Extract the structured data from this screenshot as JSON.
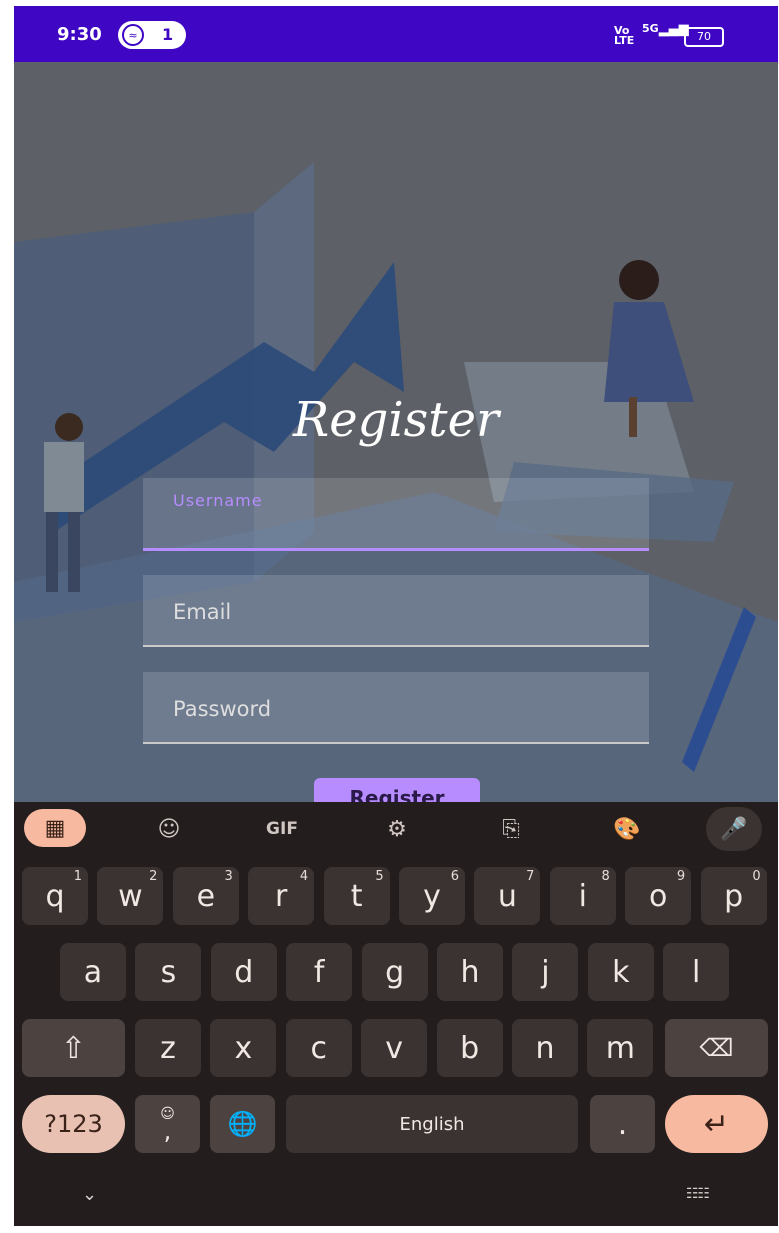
{
  "status_bar": {
    "time": "9:30",
    "hotspot_count": "1",
    "network_label_top": "Vo",
    "network_label_bottom": "LTE",
    "signal_label": "5G",
    "battery": "70"
  },
  "app": {
    "title": "Register",
    "username": {
      "label": "Username",
      "value": ""
    },
    "email": {
      "placeholder": "Email"
    },
    "password": {
      "placeholder": "Password"
    },
    "register_button": "Register"
  },
  "keyboard": {
    "toolbar": {
      "gif_label": "GIF"
    },
    "row1": [
      {
        "key": "q",
        "hint": "1"
      },
      {
        "key": "w",
        "hint": "2"
      },
      {
        "key": "e",
        "hint": "3"
      },
      {
        "key": "r",
        "hint": "4"
      },
      {
        "key": "t",
        "hint": "5"
      },
      {
        "key": "y",
        "hint": "6"
      },
      {
        "key": "u",
        "hint": "7"
      },
      {
        "key": "i",
        "hint": "8"
      },
      {
        "key": "o",
        "hint": "9"
      },
      {
        "key": "p",
        "hint": "0"
      }
    ],
    "row2": [
      "a",
      "s",
      "d",
      "f",
      "g",
      "h",
      "j",
      "k",
      "l"
    ],
    "row3": [
      "z",
      "x",
      "c",
      "v",
      "b",
      "n",
      "m"
    ],
    "symbols_key": "?123",
    "comma_key": ",",
    "space_label": "English",
    "period_key": "."
  },
  "colors": {
    "status_bar": "#3f07c4",
    "accent": "#b78cff",
    "keyboard_bg": "#231d1d",
    "key_bg": "#3b3331",
    "enter_bg": "#f7b9a0"
  }
}
